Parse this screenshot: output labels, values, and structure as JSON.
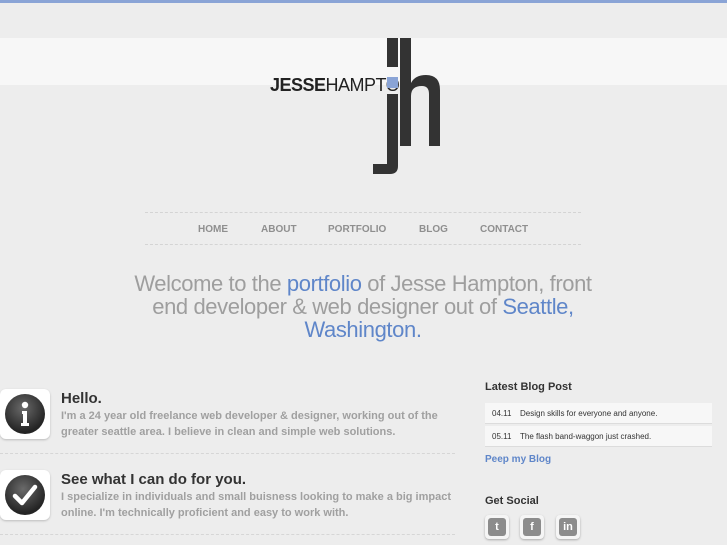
{
  "logo": {
    "first": "JESSE",
    "last": "HAMPTON",
    "mark_text": "jh",
    "accent_color": "#8aa4d6"
  },
  "nav": {
    "items": [
      "HOME",
      "ABOUT",
      "PORTFOLIO",
      "BLOG",
      "CONTACT"
    ]
  },
  "welcome": {
    "part1": "Welcome to the ",
    "link1": "portfolio",
    "part2": " of Jesse Hampton, front end developer & web designer out of ",
    "link2": "Seattle, Washington",
    "part3": "."
  },
  "blocks": [
    {
      "icon": "info-icon",
      "title": "Hello.",
      "text": "I'm a 24 year old freelance web developer & designer, working out of the greater seattle area. I believe in clean and simple web solutions."
    },
    {
      "icon": "checkmark-icon",
      "title": "See what I can do for you.",
      "text": "I specialize in individuals and small buisness looking to make a big impact online. I'm technically proficient and easy to work with."
    }
  ],
  "sidebar": {
    "blog_heading": "Latest Blog Post",
    "posts": [
      {
        "date": "04.11",
        "title": "Design skills for everyone and anyone."
      },
      {
        "date": "05.11",
        "title": "The flash band-waggon just crashed."
      }
    ],
    "blog_link": "Peep my Blog",
    "social_heading": "Get Social",
    "social": [
      {
        "name": "twitter-icon",
        "glyph": "t"
      },
      {
        "name": "facebook-icon",
        "glyph": "f"
      },
      {
        "name": "linkedin-icon",
        "glyph": "in"
      }
    ]
  }
}
